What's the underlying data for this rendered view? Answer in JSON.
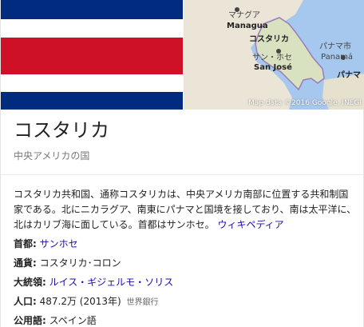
{
  "map": {
    "labels": {
      "managua_jp": "マナグア",
      "managua_en": "Managua",
      "costa_rica_jp": "コスタリカ",
      "san_jose_jp": "サン・ホセ",
      "san_jose_en": "San José",
      "panama_city_jp": "パナマ市",
      "panama_city_en": "Panamá",
      "panama_country_jp": "パナマ"
    },
    "credit": "Map data ©2016 Google, INEGI"
  },
  "flag": {
    "colors": [
      "#002b7f",
      "#ffffff",
      "#ce1126",
      "#ffffff",
      "#002b7f"
    ]
  },
  "entity": {
    "title": "コスタリカ",
    "subtitle": "中央アメリカの国"
  },
  "description": {
    "text": "コスタリカ共和国、通称コスタリカは、中央アメリカ南部に位置する共和制国家である。北にニカラグア、南東にパナマと国境を接しており、南は太平洋に、北はカリブ海に面している。首都はサンホセ。",
    "link": "ウィキペディア"
  },
  "facts": {
    "capital": {
      "label": "首都:",
      "value": "サンホセ"
    },
    "currency": {
      "label": "通貨:",
      "value": "コスタリカ･コロン"
    },
    "president": {
      "label": "大統領:",
      "value": "ルイス・ギジェルモ・ソリス"
    },
    "population": {
      "label": "人口:",
      "value": "487.2万 (2013年)",
      "source": "世界銀行"
    },
    "language": {
      "label": "公用語:",
      "value": "スペイン語"
    }
  }
}
